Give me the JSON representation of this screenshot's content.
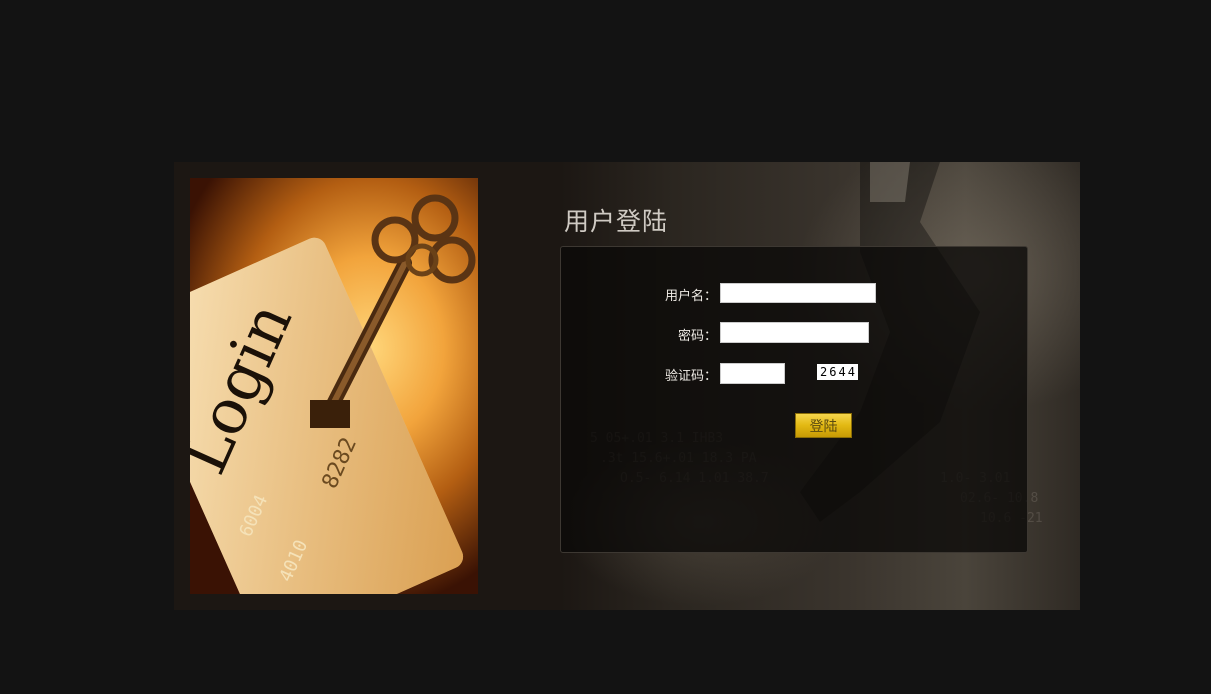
{
  "hero": {
    "card_text": "Login",
    "card_number": "8282",
    "card_digits_a": "4010",
    "card_digits_b": "6004"
  },
  "title": "用户登陆",
  "form": {
    "username_label": "用户名：",
    "username_value": "",
    "password_label": "密码：",
    "password_value": "",
    "captcha_label": "验证码：",
    "captcha_value": "",
    "captcha_code": "2644",
    "submit_label": "登陆"
  },
  "colors": {
    "page_bg": "#131313",
    "panel_bg": "#1c1713",
    "button_gold": "#e2b812"
  }
}
